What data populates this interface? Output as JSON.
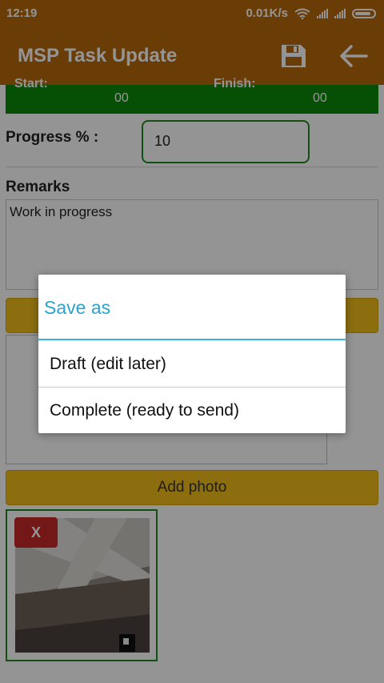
{
  "status_bar": {
    "time": "12:19",
    "speed": "0.01K/s"
  },
  "app_bar": {
    "title": "MSP Task Update"
  },
  "dates": {
    "start_label": "Start:",
    "start_value": "00",
    "finish_label": "Finish:",
    "finish_value": "00"
  },
  "progress": {
    "label": "Progress % :",
    "value": "10"
  },
  "remarks": {
    "label": "Remarks",
    "value": "Work in progress"
  },
  "add_photo": {
    "label": "Add photo"
  },
  "photo": {
    "remove_label": "X"
  },
  "dialog": {
    "title": "Save as",
    "options": [
      "Draft  (edit later)",
      "Complete  (ready to send)"
    ]
  },
  "colors": {
    "app_bar": "#b86a0b",
    "green": "#0c8a0c",
    "yellow": "#f2bd1a",
    "dialog_accent": "#33b5e5"
  }
}
